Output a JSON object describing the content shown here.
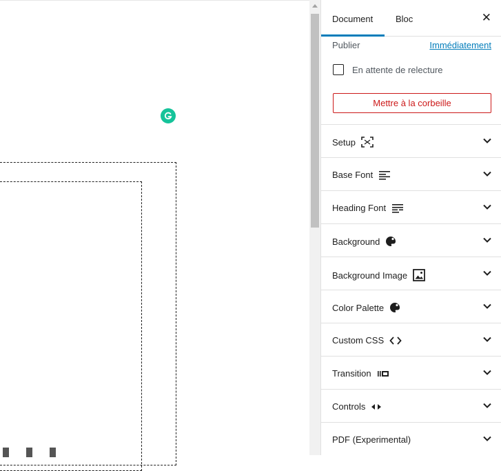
{
  "tabs": {
    "document": "Document",
    "bloc": "Bloc",
    "close": "✕"
  },
  "publish": {
    "label": "Publier",
    "value": "Immédiatement"
  },
  "review": {
    "label": "En attente de relecture",
    "checked": false
  },
  "trash": {
    "label": "Mettre à la corbeille"
  },
  "panels": [
    {
      "label": "Setup",
      "icon": "fullscreen-icon"
    },
    {
      "label": "Base Font",
      "icon": "text-align-icon"
    },
    {
      "label": "Heading Font",
      "icon": "heading-align-icon"
    },
    {
      "label": "Background",
      "icon": "palette-icon"
    },
    {
      "label": "Background Image",
      "icon": "image-icon"
    },
    {
      "label": "Color Palette",
      "icon": "palette-icon"
    },
    {
      "label": "Custom CSS",
      "icon": "code-icon"
    },
    {
      "label": "Transition",
      "icon": "transition-icon"
    },
    {
      "label": "Controls",
      "icon": "arrows-icon"
    },
    {
      "label": "PDF (Experimental)",
      "icon": ""
    }
  ],
  "colors": {
    "accent": "#007cba",
    "danger": "#cc1818",
    "grammarly": "#15c39a"
  }
}
